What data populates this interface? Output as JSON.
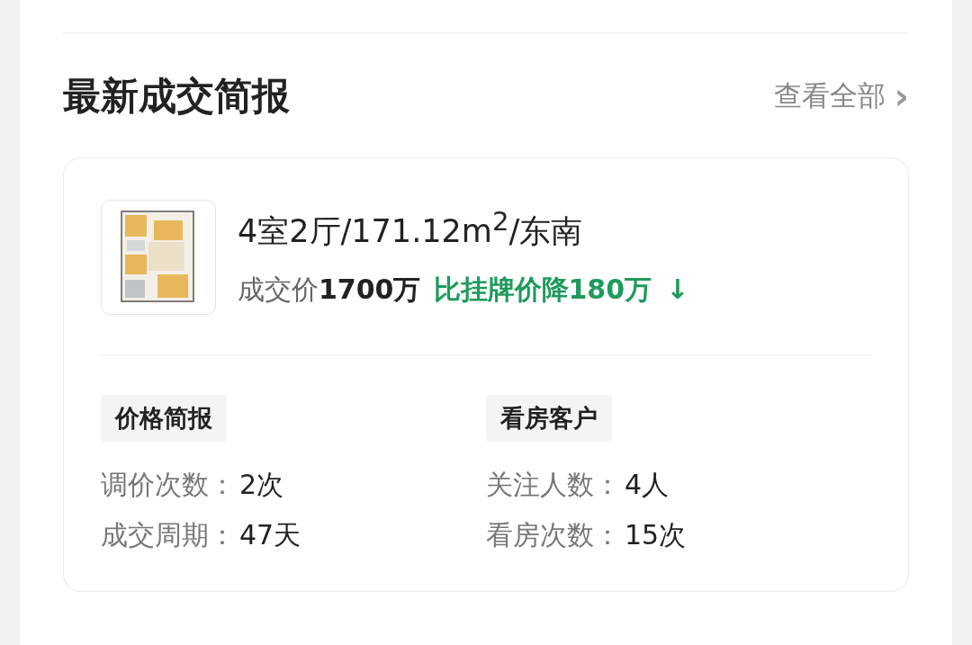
{
  "section": {
    "title": "最新成交简报",
    "view_all": "查看全部",
    "view_all_arrow": "›"
  },
  "listing": {
    "title": "4室2厅/171.12m$^{2}$/东南",
    "price_label": "成交价",
    "price": "1700万",
    "change": "比挂牌价降180万",
    "change_arrow": "↓"
  },
  "columns": [
    {
      "tag": "价格简报",
      "rows": [
        {
          "label": "调价次数：",
          "value": "2次"
        },
        {
          "label": "成交周期：",
          "value": "47天"
        }
      ]
    },
    {
      "tag": "看房客户",
      "rows": [
        {
          "label": "关注人数：",
          "value": "4人"
        },
        {
          "label": "看房次数：",
          "value": "15次"
        }
      ]
    }
  ]
}
